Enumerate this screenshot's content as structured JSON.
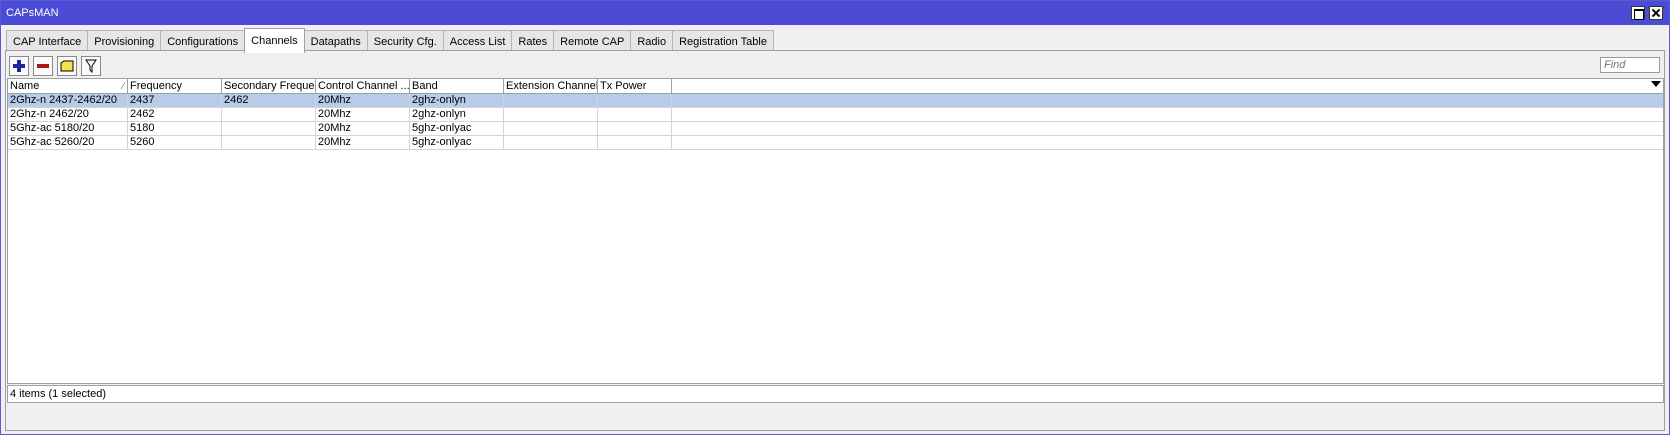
{
  "window": {
    "title": "CAPsMAN"
  },
  "tabs": [
    {
      "label": "CAP Interface"
    },
    {
      "label": "Provisioning"
    },
    {
      "label": "Configurations"
    },
    {
      "label": "Channels"
    },
    {
      "label": "Datapaths"
    },
    {
      "label": "Security Cfg."
    },
    {
      "label": "Access List"
    },
    {
      "label": "Rates"
    },
    {
      "label": "Remote CAP"
    },
    {
      "label": "Radio"
    },
    {
      "label": "Registration Table"
    }
  ],
  "active_tab": "Channels",
  "toolbar": {
    "find_placeholder": "Find"
  },
  "table": {
    "columns": [
      "Name",
      "Frequency",
      "Secondary Freque...",
      "Control Channel ...",
      "Band",
      "Extension Channel",
      "Tx Power"
    ],
    "rows": [
      [
        "2Ghz-n 2437-2462/20",
        "2437",
        "2462",
        "20Mhz",
        "2ghz-onlyn",
        "",
        ""
      ],
      [
        "2Ghz-n 2462/20",
        "2462",
        "",
        "20Mhz",
        "2ghz-onlyn",
        "",
        ""
      ],
      [
        "5Ghz-ac 5180/20",
        "5180",
        "",
        "20Mhz",
        "5ghz-onlyac",
        "",
        ""
      ],
      [
        "5Ghz-ac 5260/20",
        "5260",
        "",
        "20Mhz",
        "5ghz-onlyac",
        "",
        ""
      ]
    ],
    "selected_row": 0
  },
  "status": {
    "text": "4 items (1 selected)"
  },
  "colors": {
    "titlebar": "#4b4bd6",
    "selection": "#b8cbe8"
  }
}
